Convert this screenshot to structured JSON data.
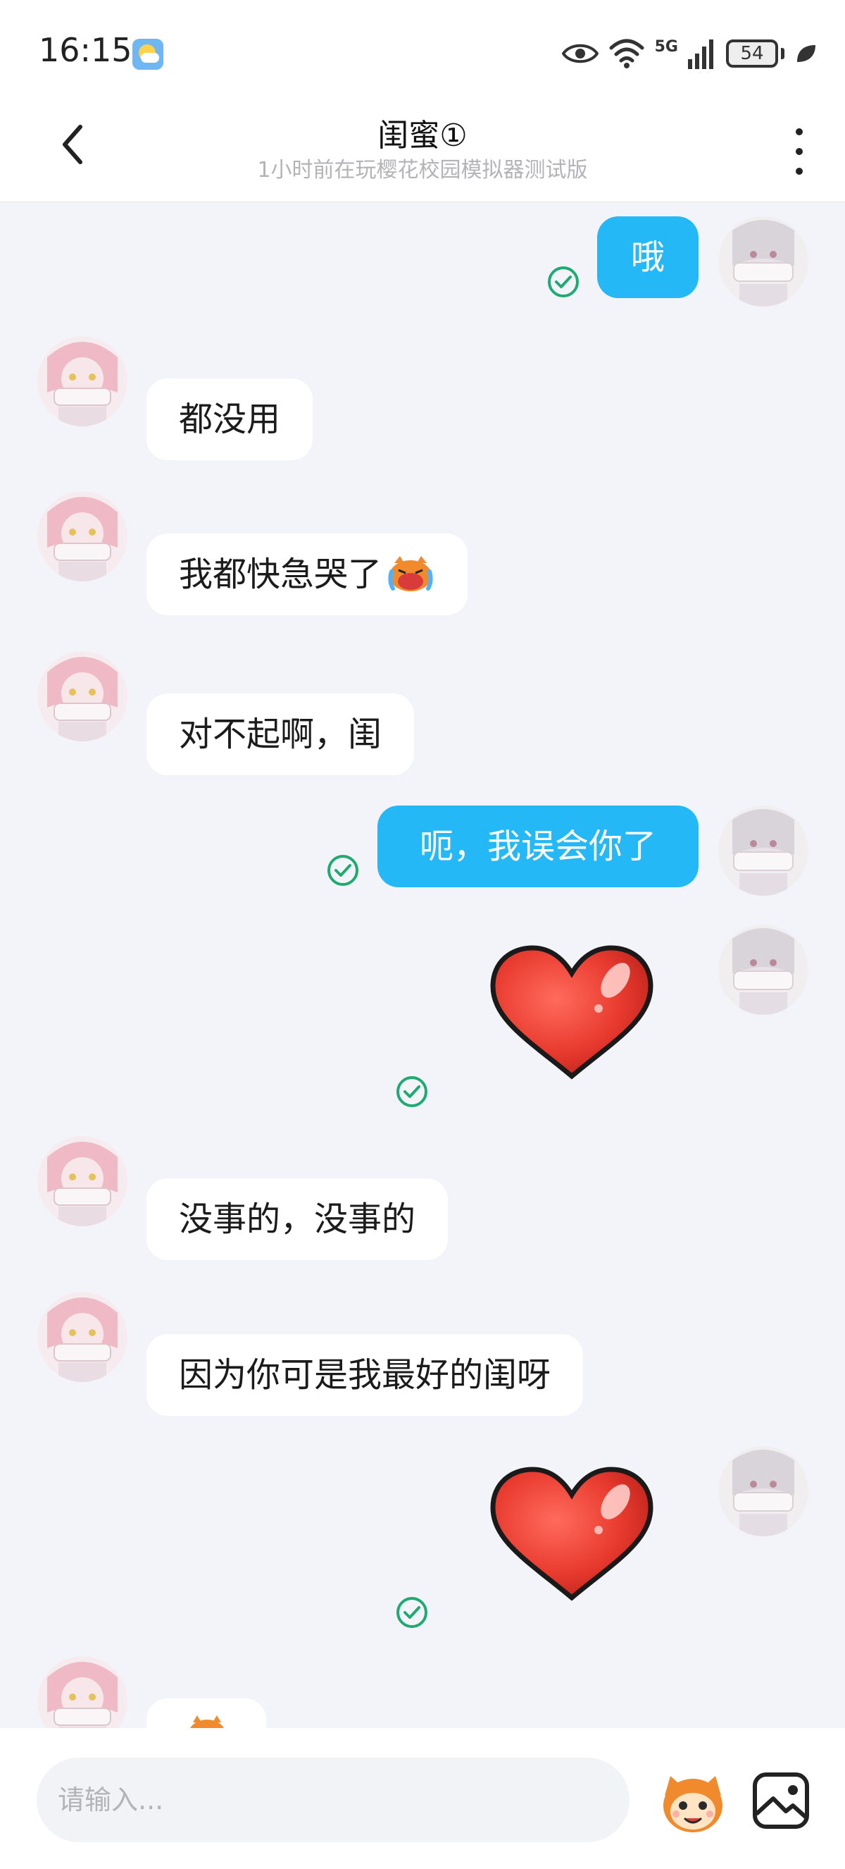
{
  "status_bar": {
    "time": "16:15",
    "network": "5G",
    "battery": "54"
  },
  "header": {
    "title": "闺蜜①",
    "subtitle": "1小时前在玩樱花校园模拟器测试版"
  },
  "messages": [
    {
      "side": "out",
      "text": "哦",
      "status": "sent"
    },
    {
      "side": "in",
      "text": "都没用"
    },
    {
      "side": "in",
      "text": "我都快急哭了",
      "emoji": "crying-face"
    },
    {
      "side": "in",
      "text": "对不起啊，闺"
    },
    {
      "side": "out",
      "text": "呃，我误会你了",
      "status": "sent"
    },
    {
      "side": "out",
      "sticker": "red-heart",
      "status": "sent"
    },
    {
      "side": "in",
      "text": "没事的，没事的"
    },
    {
      "side": "in",
      "text": "因为你可是我最好的闺呀"
    },
    {
      "side": "out",
      "sticker": "red-heart",
      "status": "sent"
    },
    {
      "side": "in",
      "text": ""
    }
  ],
  "input_bar": {
    "placeholder": "请输入..."
  },
  "colors": {
    "outgoing_bubble": "#25b8f7",
    "incoming_bubble": "#ffffff",
    "chat_background": "#f3f4f9",
    "sent_check": "#1faa72"
  }
}
